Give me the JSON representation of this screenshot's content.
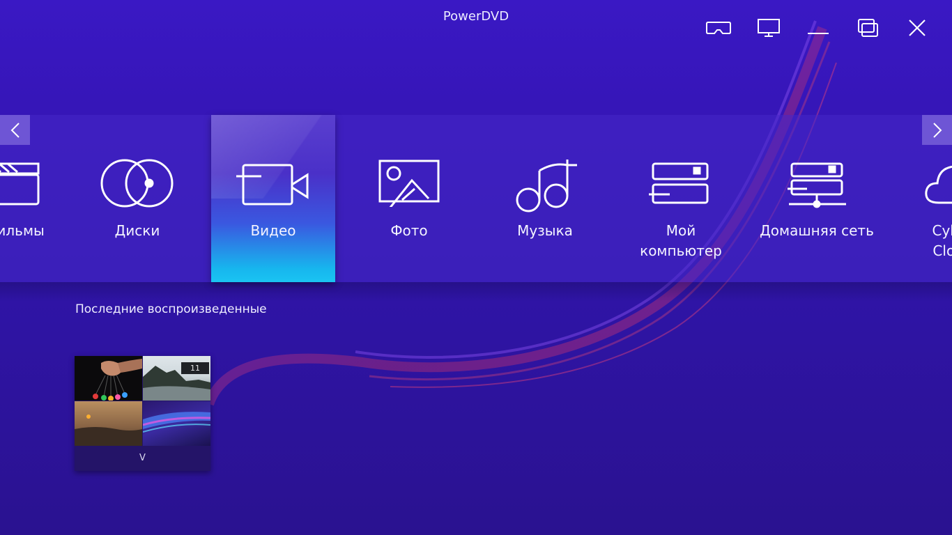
{
  "app": {
    "title": "PowerDVD"
  },
  "window_controls": [
    "vr-mode",
    "tv-mode",
    "minimize",
    "restore",
    "close"
  ],
  "categories": [
    {
      "label": "Фильмы",
      "icon": "clapperboard-icon"
    },
    {
      "label": "Диски",
      "icon": "discs-icon"
    },
    {
      "label": "Видео",
      "icon": "video-camera-icon",
      "selected": true
    },
    {
      "label": "Фото",
      "icon": "photo-icon"
    },
    {
      "label": "Музыка",
      "icon": "music-notes-icon"
    },
    {
      "label": "Мой\nкомпьютер",
      "icon": "my-computer-icon"
    },
    {
      "label": "Домашняя сеть",
      "icon": "home-network-icon"
    },
    {
      "label": "Cyber\nCloud",
      "icon": "cloud-icon"
    }
  ],
  "recent": {
    "title": "Последние воспроизведенные",
    "items": [
      {
        "label": "V",
        "count": "11"
      }
    ]
  },
  "colors": {
    "selected_top": "#4a30c8",
    "selected_bottom": "#1ac4f2",
    "background": "#3616b8"
  }
}
